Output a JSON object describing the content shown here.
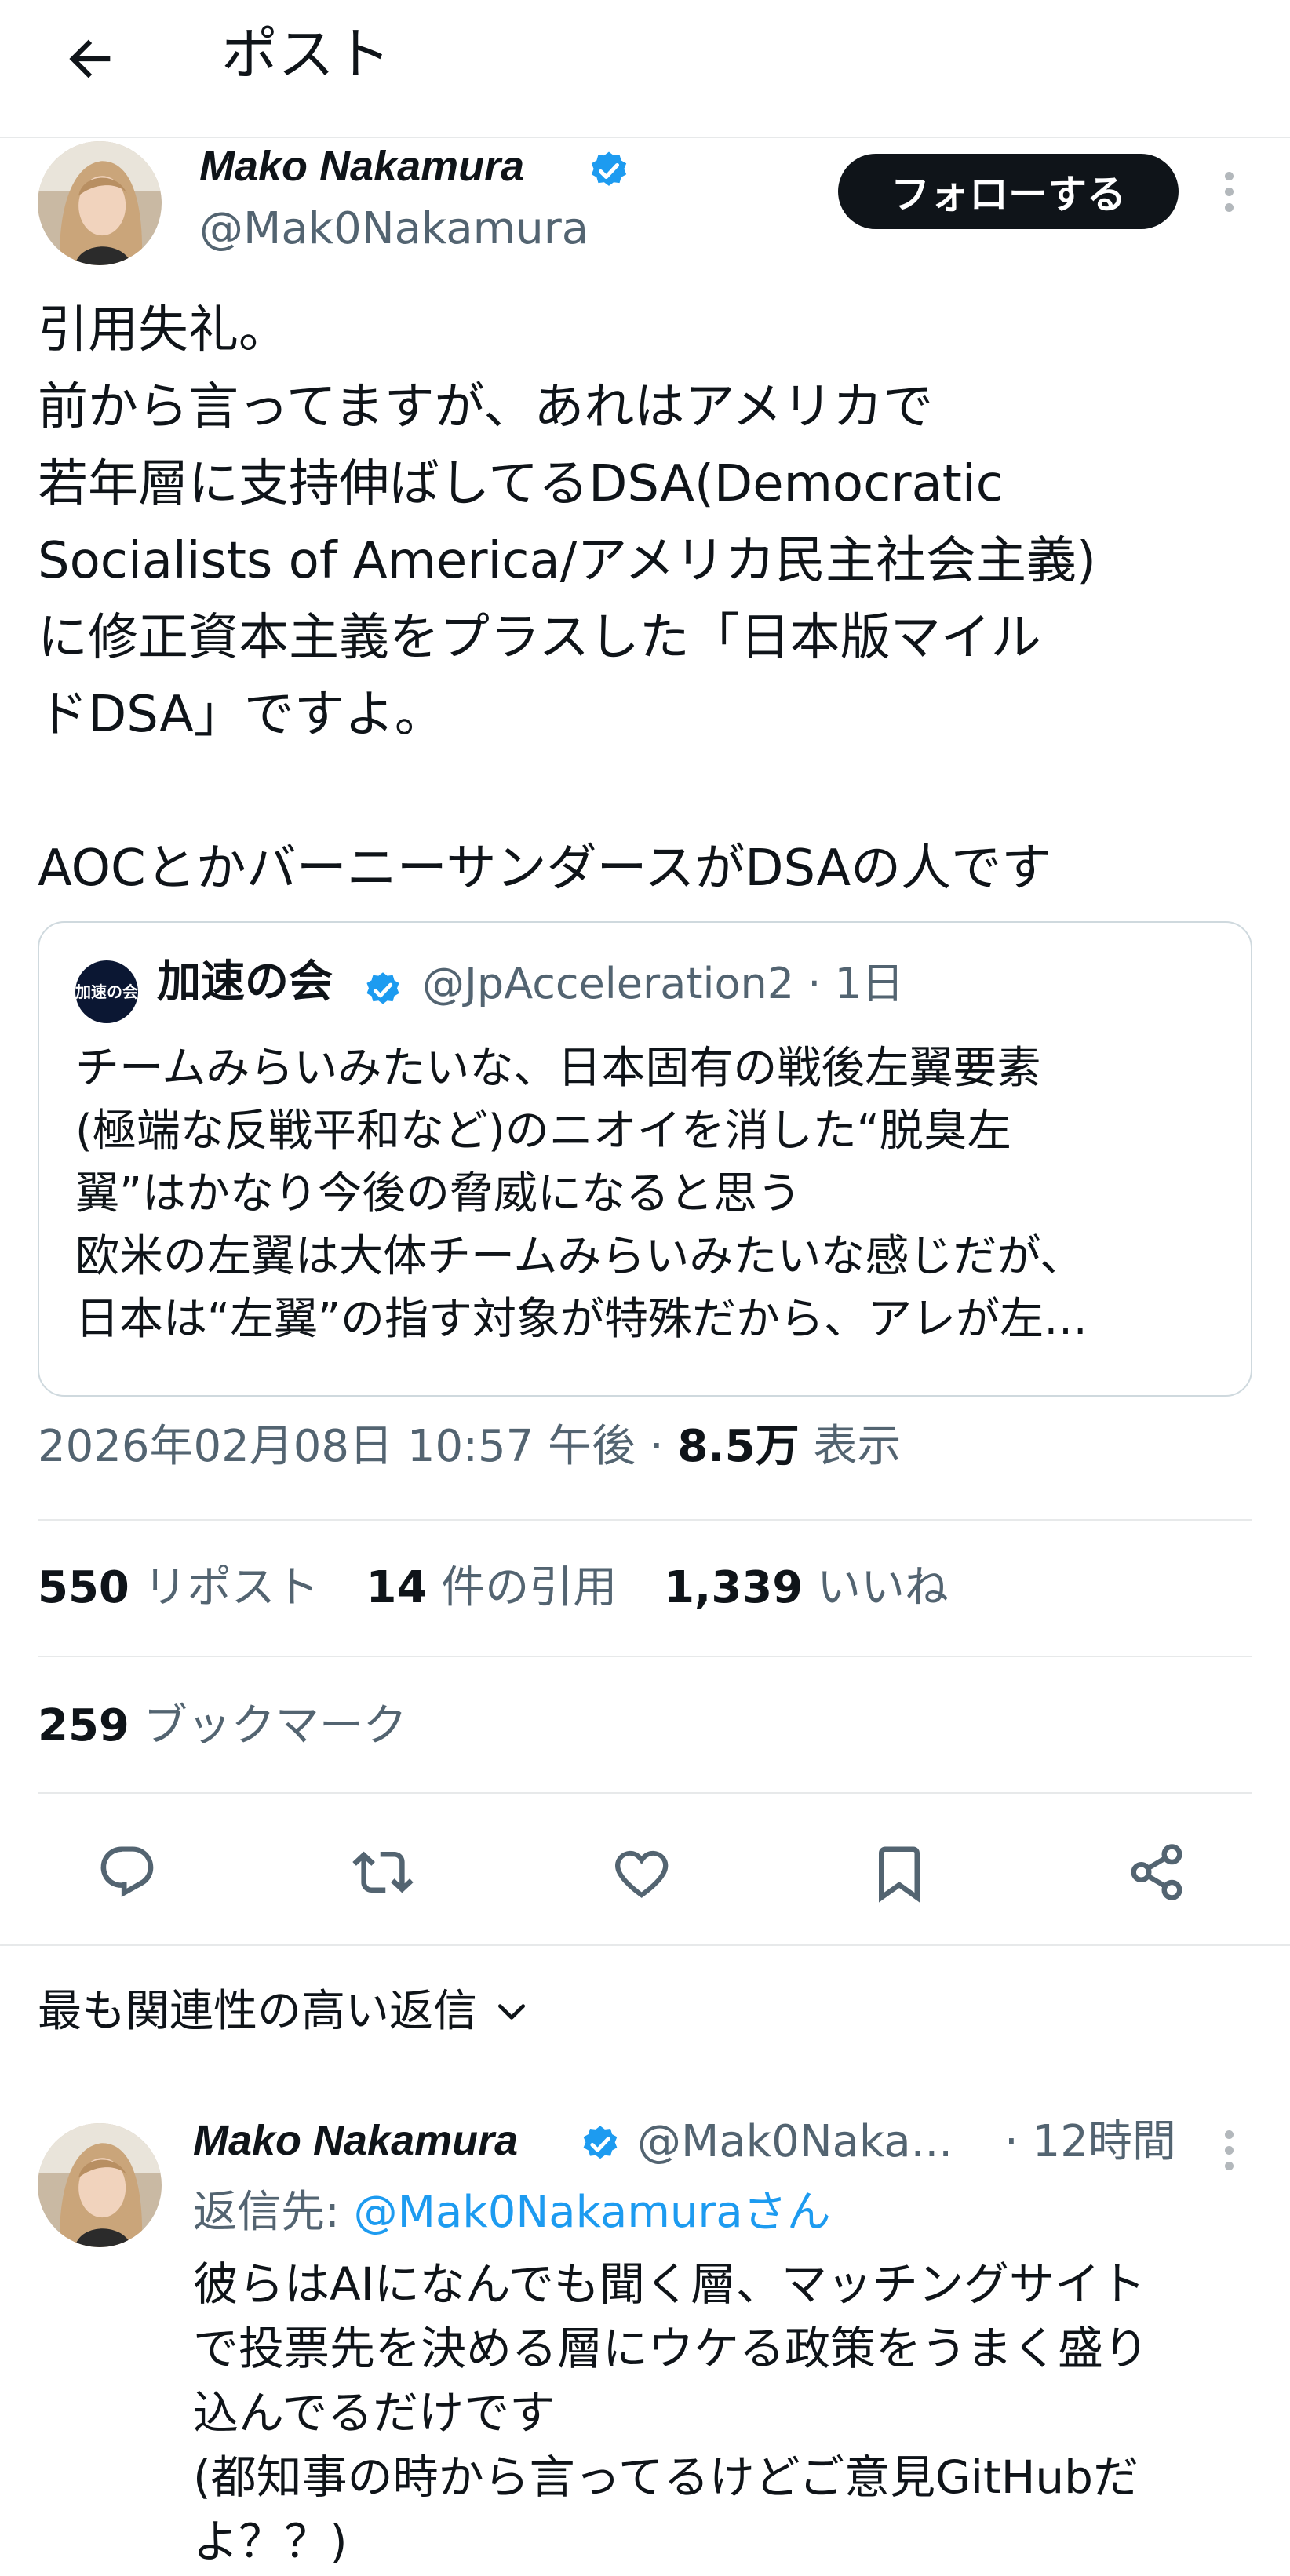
{
  "header": {
    "title": "ポスト",
    "back_icon": "arrow-left-icon"
  },
  "tweet": {
    "author_name": "Mako Nakamura",
    "author_handle": "@Mak0Nakamura",
    "follow_label": "フォローする",
    "body": "引用失礼。\n前から言ってますが、あれはアメリカで\n若年層に支持伸ばしてるDSA(Democratic\nSocialists of America/アメリカ民主社会主義)\nに修正資本主義をプラスした「日本版マイル\nドDSA」ですよ。\n\nAOCとかバーニーサンダースがDSAの人です",
    "quote": {
      "avatar_label": "加速の会",
      "name": "加速の会",
      "handle_time": "@JpAcceleration2 · 1日",
      "lines": [
        "チームみらいみたいな、日本固有の戦後左翼要素",
        "(極端な反戦平和など)のニオイを消した“脱臭左",
        "翼”はかなり今後の脅威になると思う",
        "欧米の左翼は大体チームみらいみたいな感じだが、",
        "日本は“左翼”の指す対象が特殊だから、アレが左…"
      ]
    },
    "timestamp": "2026年02月08日 10:57 午後 · ",
    "views_count": "8.5万",
    "views_label": " 表示",
    "stats": {
      "reposts_num": "550",
      "reposts_label": " リポスト",
      "quotes_num": "14",
      "quotes_label": " 件の引用",
      "likes_num": "1,339",
      "likes_label": " いいね",
      "bookmarks_num": "259",
      "bookmarks_label": " ブックマーク"
    },
    "actions": [
      "reply-icon",
      "repost-icon",
      "like-icon",
      "bookmark-icon",
      "share-icon"
    ]
  },
  "replies_sort": {
    "label": "最も関連性の高い返信",
    "icon": "chevron-down-icon"
  },
  "reply": {
    "author_name": "Mako Nakamura",
    "author_handle": "@Mak0Naka...",
    "time": "· 12時間",
    "reply_to_prefix": "返信先: ",
    "reply_to_handle": "@Mak0Nakamuraさん",
    "body": "彼らはAIになんでも聞く層、マッチングサイト\nで投票先を決める層にウケる政策をうまく盛り\n込んでるだけです\n(都知事の時から言ってるけどご意見GitHubだ\nよ？？)"
  },
  "colors": {
    "text": "#0f1419",
    "secondary": "#536471",
    "accent": "#1d9bf0",
    "verified": "#1d9bf0",
    "divider": "#e7e9ea"
  }
}
